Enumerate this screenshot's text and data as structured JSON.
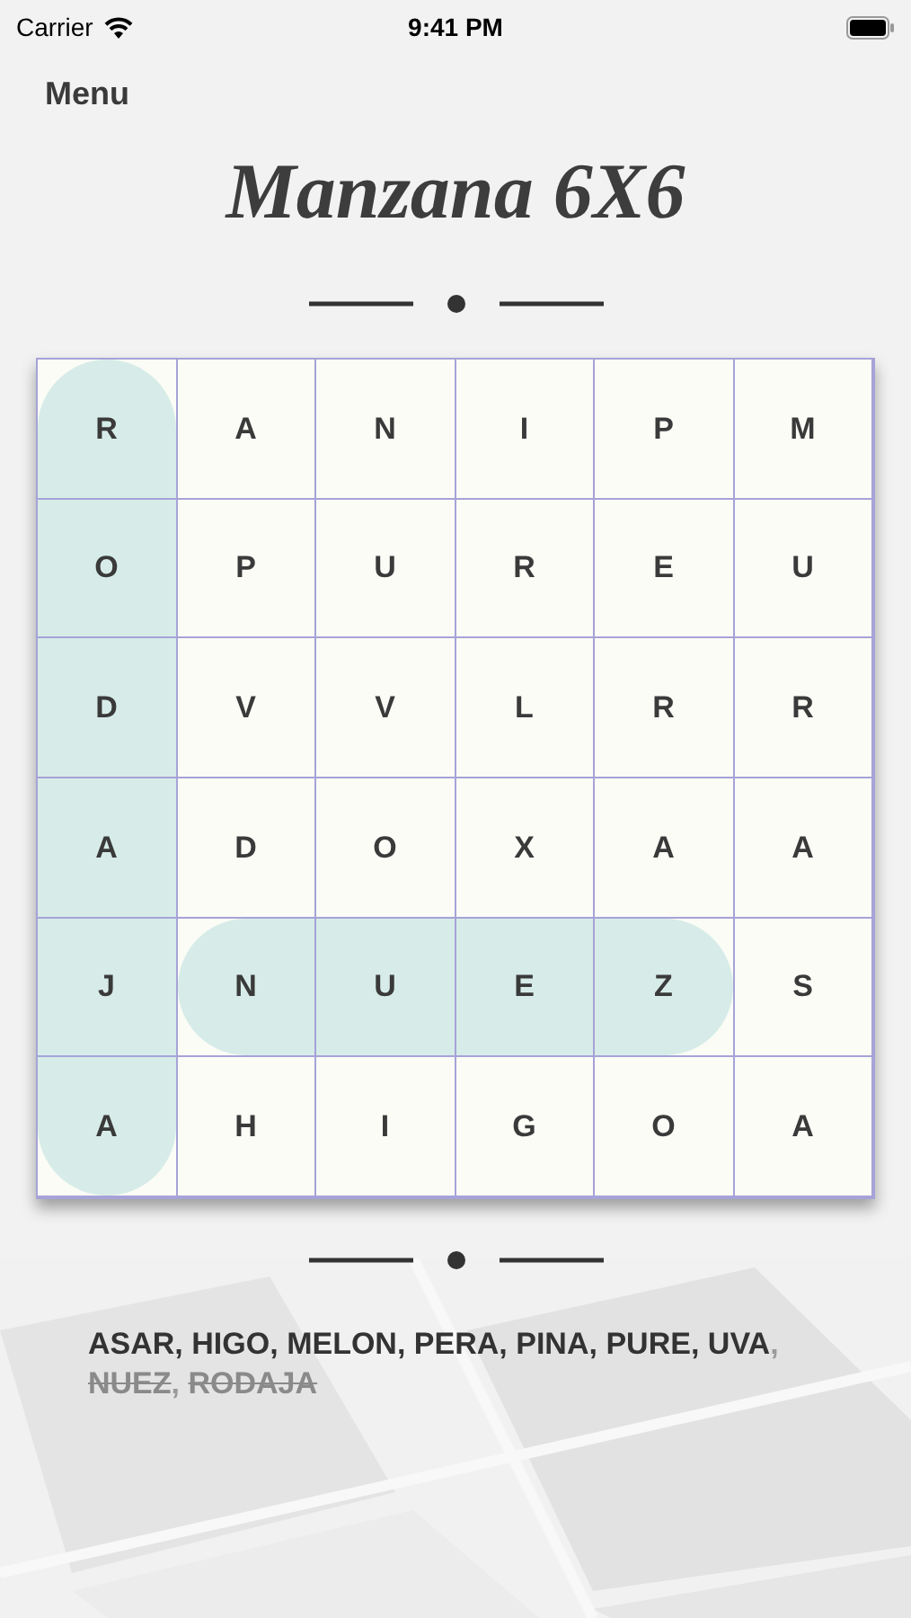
{
  "status_bar": {
    "carrier": "Carrier",
    "time": "9:41 PM"
  },
  "nav": {
    "menu": "Menu"
  },
  "title": "Manzana 6X6",
  "grid": [
    [
      {
        "letter": "R",
        "vertical_highlight": true
      },
      {
        "letter": "A"
      },
      {
        "letter": "N"
      },
      {
        "letter": "I"
      },
      {
        "letter": "P"
      },
      {
        "letter": "M"
      }
    ],
    [
      {
        "letter": "O",
        "vertical_highlight": true
      },
      {
        "letter": "P"
      },
      {
        "letter": "U"
      },
      {
        "letter": "R"
      },
      {
        "letter": "E"
      },
      {
        "letter": "U"
      }
    ],
    [
      {
        "letter": "D",
        "vertical_highlight": true
      },
      {
        "letter": "V"
      },
      {
        "letter": "V"
      },
      {
        "letter": "L"
      },
      {
        "letter": "R"
      },
      {
        "letter": "R"
      }
    ],
    [
      {
        "letter": "A",
        "vertical_highlight": true
      },
      {
        "letter": "D"
      },
      {
        "letter": "O"
      },
      {
        "letter": "X"
      },
      {
        "letter": "A"
      },
      {
        "letter": "A"
      }
    ],
    [
      {
        "letter": "J",
        "vertical_highlight": true
      },
      {
        "letter": "N",
        "horizontal_highlight": true
      },
      {
        "letter": "U",
        "horizontal_highlight": true
      },
      {
        "letter": "E",
        "horizontal_highlight": true
      },
      {
        "letter": "Z",
        "horizontal_highlight": true
      },
      {
        "letter": "S"
      }
    ],
    [
      {
        "letter": "A",
        "vertical_highlight": true
      },
      {
        "letter": "H"
      },
      {
        "letter": "I"
      },
      {
        "letter": "G"
      },
      {
        "letter": "O"
      },
      {
        "letter": "A"
      }
    ]
  ],
  "separator": ",",
  "words": [
    {
      "text": "ASAR",
      "found": false
    },
    {
      "text": "HIGO",
      "found": false
    },
    {
      "text": "MELON",
      "found": false
    },
    {
      "text": "PERA",
      "found": false
    },
    {
      "text": "PINA",
      "found": false
    },
    {
      "text": "PURE",
      "found": false
    },
    {
      "text": "UVA",
      "found": false
    },
    {
      "text": "NUEZ",
      "found": true
    },
    {
      "text": "RODAJA",
      "found": true
    }
  ]
}
